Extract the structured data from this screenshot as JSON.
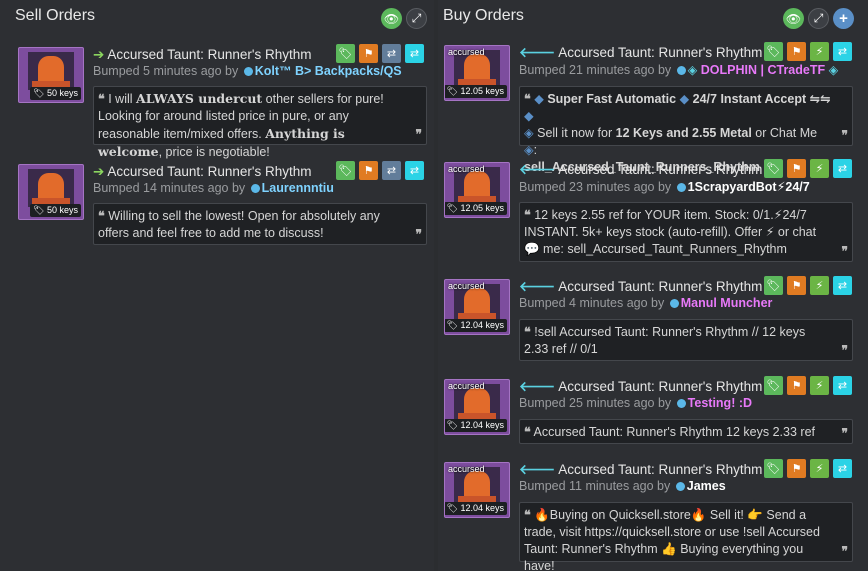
{
  "sell": {
    "title": "Sell Orders",
    "listings": [
      {
        "name": "Accursed Taunt: Runner's Rhythm",
        "price": "50 keys",
        "bumped": "Bumped 5 minutes ago by",
        "user": "Kolt™ B> Backpacks/QS",
        "user_color": "#7fd3ff",
        "comment_parts": [
          "I will ",
          "ALWAYS undercut",
          " other sellers for pure! Looking for around listed price in pure, or any reasonable item/mixed offers. ",
          "Anything is welcome",
          ", price is negotiable!"
        ]
      },
      {
        "name": "Accursed Taunt: Runner's Rhythm",
        "price": "50 keys",
        "bumped": "Bumped 14 minutes ago by",
        "user": "Laurennntiu",
        "user_color": "#7fd3ff",
        "comment": "Willing to sell the lowest! Open for absolutely any offers and feel free to add me to discuss!"
      }
    ]
  },
  "buy": {
    "title": "Buy Orders",
    "listings": [
      {
        "thumb_label": "accursed",
        "name": "Accursed Taunt: Runner's Rhythm",
        "price": "12.05 keys",
        "bumped": "Bumped 21 minutes ago by",
        "user": "DOLPHIN | CTradeTF",
        "user_color": "#e879f9",
        "comment_parts": [
          "Super Fast Automatic",
          "24/7 Instant Accept ⇋⇋",
          "Sell it now for ",
          "12 Keys and 2.55 Metal",
          " or Chat Me",
          "sell_Accursed_Taunt_Runners_Rhythm"
        ]
      },
      {
        "thumb_label": "accursed",
        "name": "Accursed Taunt: Runner's Rhythm",
        "price": "12.05 keys",
        "bumped": "Bumped 23 minutes ago by",
        "user": "1ScrapyardBot⚡24/7",
        "user_color": "#ffffff",
        "comment": "12 keys 2.55 ref for YOUR item. Stock: 0/1.⚡24/7 INSTANT. 5k+ keys stock (auto-refill). Offer ⚡ or chat 💬 me: sell_Accursed_Taunt_Runners_Rhythm"
      },
      {
        "thumb_label": "accursed",
        "name": "Accursed Taunt: Runner's Rhythm",
        "price": "12.04 keys",
        "bumped": "Bumped 4 minutes ago by",
        "user": "Manul Muncher",
        "user_color": "#e879f9",
        "comment": "!sell Accursed Taunt: Runner's Rhythm // 12 keys 2.33 ref // 0/1"
      },
      {
        "thumb_label": "accursed",
        "name": "Accursed Taunt: Runner's Rhythm",
        "price": "12.04 keys",
        "bumped": "Bumped 25 minutes ago by",
        "user": "Testing! :D",
        "user_color": "#e879f9",
        "comment": "Accursed Taunt: Runner's Rhythm 12 keys 2.33 ref"
      },
      {
        "thumb_label": "accursed",
        "name": "Accursed Taunt: Runner's Rhythm",
        "price": "12.04 keys",
        "bumped": "Bumped 11 minutes ago by",
        "user": "James",
        "user_color": "#ffffff",
        "comment": "🔥Buying on Quicksell.store🔥 Sell it! 👉 Send a trade, visit https://quicksell.store or use !sell Accursed Taunt: Runner's Rhythm 👍 Buying everything you have!"
      }
    ]
  },
  "colors": {
    "green": "#5cb85c",
    "orange": "#e07b22",
    "cyan": "#2bd3e6",
    "gray": "#627d9a",
    "thumb_purple": "#7d4d9e"
  }
}
